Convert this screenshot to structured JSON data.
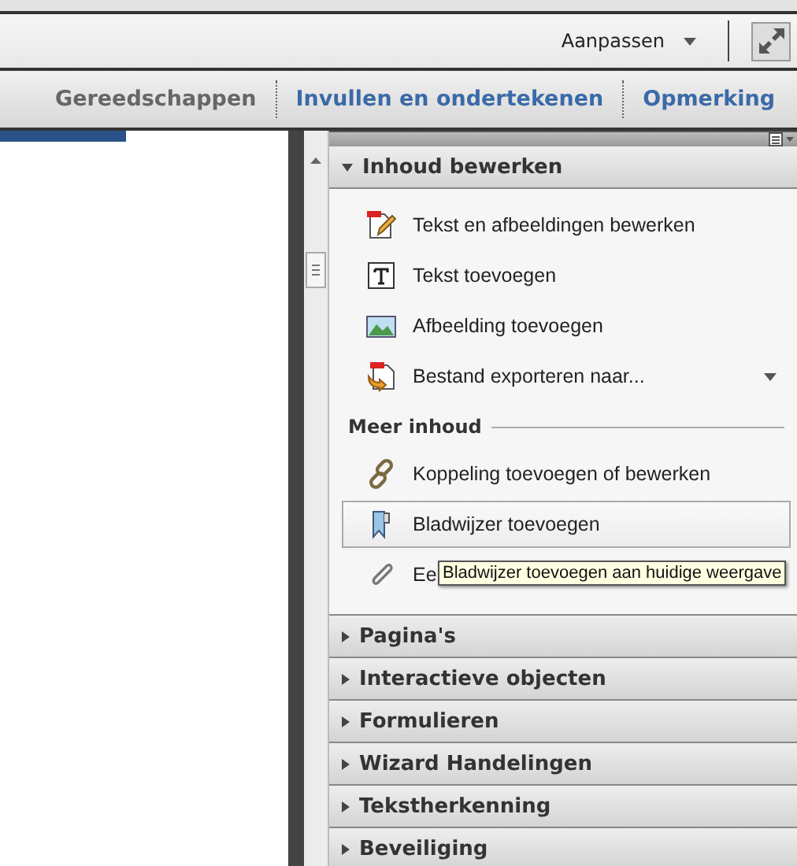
{
  "toolbar": {
    "customize_menu": "Aanpassen"
  },
  "tabs": [
    {
      "label": "Gereedschappen",
      "selected": true
    },
    {
      "label": "Invullen en ondertekenen",
      "selected": false
    },
    {
      "label": "Opmerking",
      "selected": false
    }
  ],
  "panel": {
    "sections": [
      {
        "title": "Inhoud bewerken",
        "expanded": true,
        "items": [
          {
            "kind": "tool",
            "label": "Tekst en afbeeldingen bewerken",
            "dropdown": false,
            "hovered": false
          },
          {
            "kind": "tool",
            "label": "Tekst toevoegen",
            "dropdown": false,
            "hovered": false
          },
          {
            "kind": "tool",
            "label": "Afbeelding toevoegen",
            "dropdown": false,
            "hovered": false
          },
          {
            "kind": "tool",
            "label": "Bestand exporteren naar...",
            "dropdown": true,
            "hovered": false
          },
          {
            "kind": "heading",
            "label": "Meer inhoud"
          },
          {
            "kind": "tool",
            "label": "Koppeling toevoegen of bewerken",
            "dropdown": false,
            "hovered": false
          },
          {
            "kind": "tool",
            "label": "Bladwijzer toevoegen",
            "dropdown": false,
            "hovered": true
          },
          {
            "kind": "tool",
            "label": "Ee",
            "dropdown": false,
            "hovered": false,
            "tooltip": "Bladwijzer toevoegen aan huidige weergave"
          }
        ]
      },
      {
        "title": "Pagina's",
        "expanded": false
      },
      {
        "title": "Interactieve objecten",
        "expanded": false
      },
      {
        "title": "Formulieren",
        "expanded": false
      },
      {
        "title": "Wizard Handelingen",
        "expanded": false
      },
      {
        "title": "Tekstherkenning",
        "expanded": false
      },
      {
        "title": "Beveiliging",
        "expanded": false
      }
    ]
  }
}
